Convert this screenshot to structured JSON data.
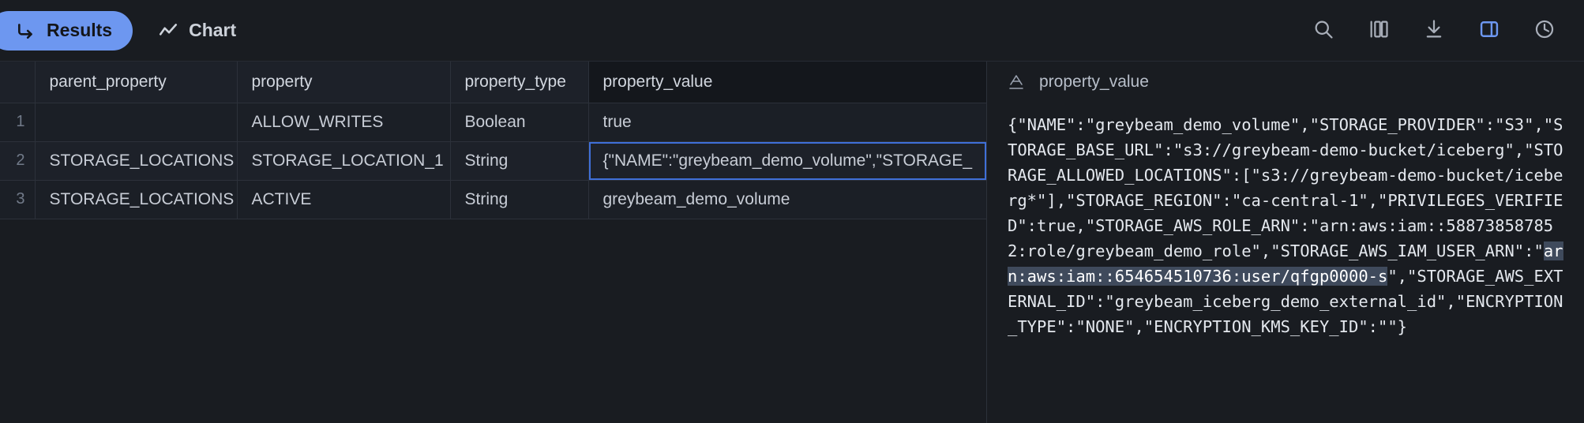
{
  "toolbar": {
    "tabs": [
      {
        "label": "Results",
        "icon": "results-arrow-icon",
        "active": true
      },
      {
        "label": "Chart",
        "icon": "chart-line-icon",
        "active": false
      }
    ],
    "tools": [
      {
        "name": "search-icon",
        "active": false
      },
      {
        "name": "columns-icon",
        "active": false
      },
      {
        "name": "download-icon",
        "active": false
      },
      {
        "name": "split-panel-icon",
        "active": true
      },
      {
        "name": "history-clock-icon",
        "active": false
      }
    ],
    "accent_color": "#6d97f0"
  },
  "grid": {
    "columns": [
      "parent_property",
      "property",
      "property_type",
      "property_value"
    ],
    "selected_column": "property_value",
    "selected_cell": {
      "row": 2,
      "column": "property_value"
    },
    "rows": [
      {
        "num": "1",
        "parent_property": "",
        "property": "ALLOW_WRITES",
        "property_type": "Boolean",
        "property_value": "true"
      },
      {
        "num": "2",
        "parent_property": "STORAGE_LOCATIONS",
        "property": "STORAGE_LOCATION_1",
        "property_type": "String",
        "property_value": "{\"NAME\":\"greybeam_demo_volume\",\"STORAGE_"
      },
      {
        "num": "3",
        "parent_property": "STORAGE_LOCATIONS",
        "property": "ACTIVE",
        "property_type": "String",
        "property_value": "greybeam_demo_volume"
      }
    ]
  },
  "detail": {
    "type_icon": "text-type-icon",
    "type_glyph": "A",
    "title": "property_value",
    "value_parts": [
      {
        "text": "{\"NAME\":\"greybeam_demo_volume\",\"STORAGE_PROVIDER\":\"S3\",\"STORAGE_BASE_URL\":\"s3://greybeam-demo-bucket/iceberg\",\"STORAGE_ALLOWED_LOCATIONS\":[\"s3://greybeam-demo-bucket/iceberg*\"],\"STORAGE_REGION\":\"ca-central-1\",\"PRIVILEGES_VERIFIED\":true,\"STORAGE_AWS_ROLE_ARN\":\"arn:aws:iam::588738587852:role/greybeam_demo_role\",\"STORAGE_AWS_IAM_USER_ARN\":\"",
        "selected": false
      },
      {
        "text": "arn:aws:iam::654654510736:user/qfgp0000-s",
        "selected": true
      },
      {
        "text": "\",\"STORAGE_AWS_EXTERNAL_ID\":\"greybeam_iceberg_demo_external_id\",\"ENCRYPTION_TYPE\":\"NONE\",\"ENCRYPTION_KMS_KEY_ID\":\"\"}",
        "selected": false
      }
    ],
    "selection_color": "#3f4a5c"
  }
}
